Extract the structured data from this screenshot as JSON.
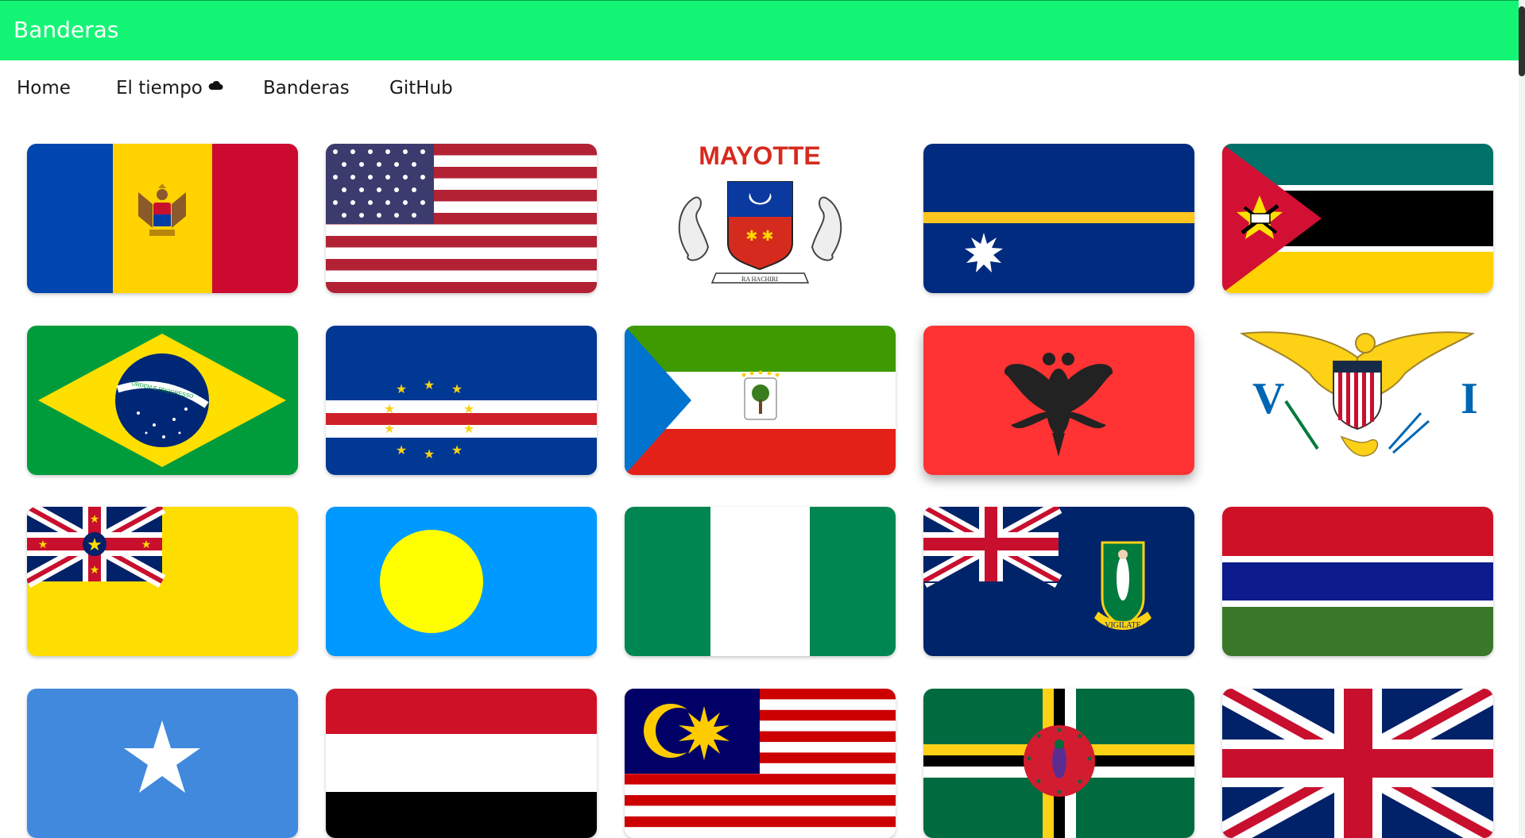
{
  "app": {
    "title": "Banderas"
  },
  "colors": {
    "appbar": "#14f575",
    "text": "#1a1a1a"
  },
  "nav": {
    "items": [
      {
        "label": "Home"
      },
      {
        "label": "El tiempo",
        "icon": "cloud-icon"
      },
      {
        "label": "Banderas"
      },
      {
        "label": "GitHub"
      }
    ]
  },
  "flags": [
    {
      "name": "moldova-flag"
    },
    {
      "name": "united-states-flag"
    },
    {
      "name": "mayotte-flag",
      "text": "MAYOTTE",
      "motto": "RA HACHIRI"
    },
    {
      "name": "nauru-flag"
    },
    {
      "name": "mozambique-flag"
    },
    {
      "name": "brazil-flag",
      "motto": "ORDEM E PROGRESSO"
    },
    {
      "name": "cape-verde-flag"
    },
    {
      "name": "equatorial-guinea-flag"
    },
    {
      "name": "albania-flag"
    },
    {
      "name": "us-virgin-islands-flag",
      "left_letter": "V",
      "right_letter": "I"
    },
    {
      "name": "niue-flag"
    },
    {
      "name": "palau-flag"
    },
    {
      "name": "nigeria-flag"
    },
    {
      "name": "british-virgin-islands-flag",
      "motto": "VIGILATE"
    },
    {
      "name": "gambia-flag"
    },
    {
      "name": "somalia-flag"
    },
    {
      "name": "yemen-flag"
    },
    {
      "name": "malaysia-flag"
    },
    {
      "name": "dominica-flag"
    },
    {
      "name": "united-kingdom-flag"
    }
  ]
}
